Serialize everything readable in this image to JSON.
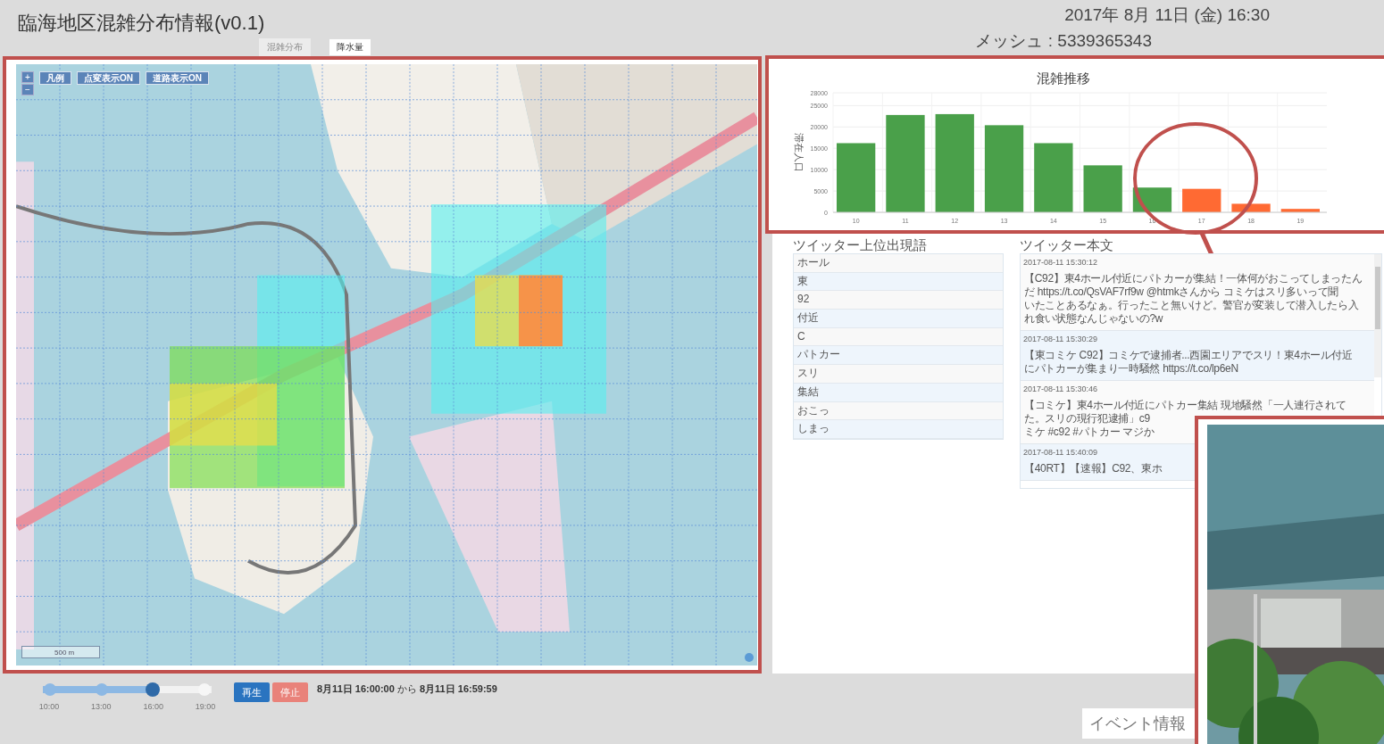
{
  "header": {
    "title": "臨海地区混雑分布情報(v0.1)",
    "tabs": [
      {
        "label": "混雑分布",
        "selected": false
      },
      {
        "label": "降水量",
        "selected": true
      }
    ],
    "datetime": "2017年 8月 11日 (金) 16:30",
    "mesh": "メッシュ : 5339365343"
  },
  "map": {
    "zoom_in": "+",
    "zoom_out": "−",
    "buttons": [
      "凡例",
      "点変表示ON",
      "道路表示ON"
    ],
    "scale": "500 m"
  },
  "chart": {
    "chart_data": {
      "type": "bar",
      "title": "混雑推移",
      "ylabel": "滞在人口",
      "stacked": true,
      "grid": true,
      "categories": [
        "10",
        "11",
        "12",
        "13",
        "14",
        "15",
        "16",
        "17",
        "18",
        "19"
      ],
      "series": [
        {
          "color": "#4aa04a",
          "values": [
            16200,
            22800,
            23000,
            20400,
            16200,
            11000,
            5800,
            null,
            null,
            null
          ]
        },
        {
          "color": "#ff6a33",
          "values": [
            null,
            null,
            null,
            null,
            null,
            null,
            null,
            5500,
            2000,
            800
          ]
        }
      ],
      "ylim": [
        0,
        28000
      ],
      "yticks": [
        0,
        5000,
        10000,
        15000,
        20000,
        25000,
        28000
      ]
    }
  },
  "keywords": {
    "title": "ツイッター上位出現語",
    "items": [
      "ホール",
      "東",
      "92",
      "付近",
      "C",
      "パトカー",
      "スリ",
      "集結",
      "おこっ",
      "しまっ"
    ]
  },
  "tweets": {
    "title": "ツイッター本文",
    "items": [
      {
        "time": "2017-08-11 15:30:12",
        "lines": [
          "【C92】東4ホール付近にパトカーが集結！一体何がおこってしまったん",
          "だ https://t.co/QsVAF7rf9w @htmkさんから コミケはスリ多いって聞",
          "いたことあるなぁ。行ったこと無いけど。警官が変装して潜入したら入",
          "れ食い状態なんじゃないの?w"
        ]
      },
      {
        "time": "2017-08-11 15:30:29",
        "lines": [
          "【東コミケ C92】コミケで逮捕者...西園エリアでスリ！東4ホール付近",
          "にパトカーが集まり一時騒然 https://t.co/lp6eN"
        ]
      },
      {
        "time": "2017-08-11 15:30:46",
        "lines": [
          "【コミケ】東4ホール付近にパトカー集結 現地騒然「一人連行されて",
          "た。スリの現行犯逮捕」c9",
          "ミケ #c92 #パトカー マジか"
        ]
      },
      {
        "time": "2017-08-11 15:40:09",
        "lines": [
          "【40RT】【速報】C92、東ホ"
        ]
      }
    ]
  },
  "timeline": {
    "ticks": [
      "10:00",
      "13:00",
      "16:00",
      "19:00"
    ],
    "level": 0.667,
    "play": "再生",
    "stop": "停止",
    "range": "**8月11日 16:00:00** から **8月11日 16:59:59**"
  },
  "event": {
    "title": "イベント情報"
  }
}
